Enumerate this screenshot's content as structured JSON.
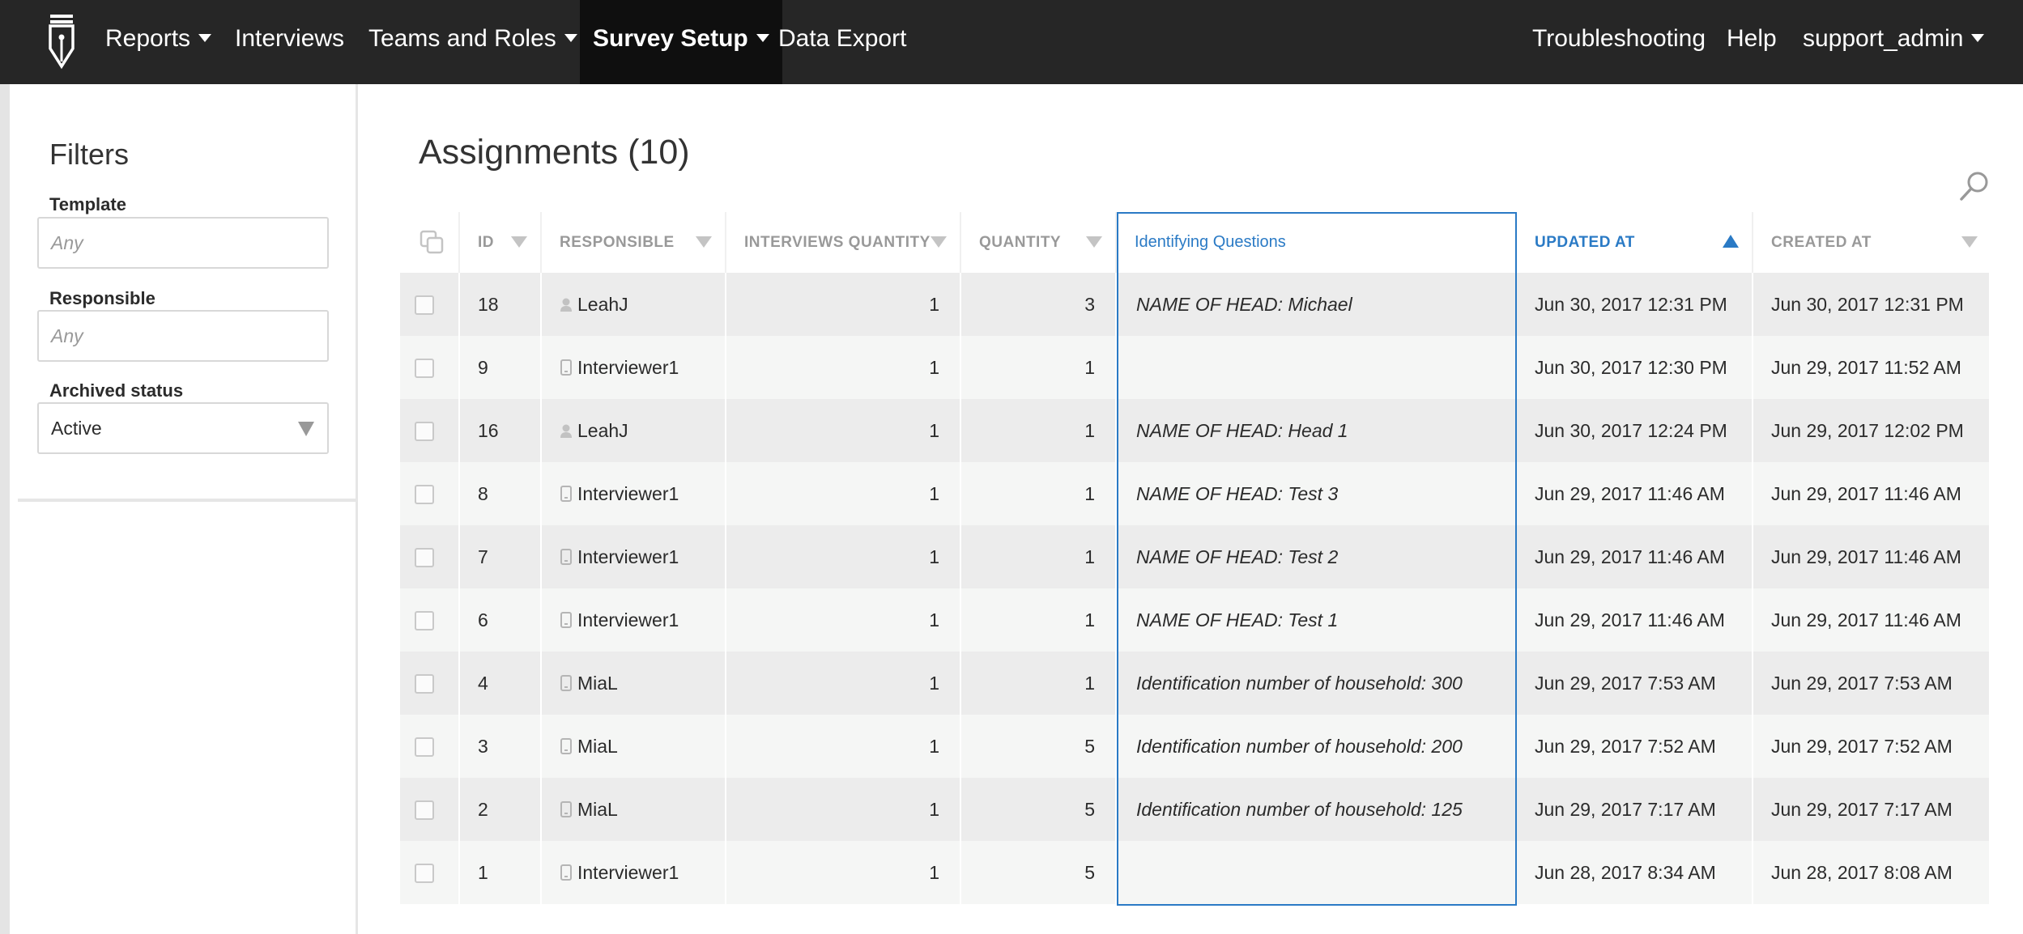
{
  "nav": {
    "logo_icon": "pen-nib-logo-icon",
    "items": [
      {
        "label": "Reports",
        "has_caret": true
      },
      {
        "label": "Interviews",
        "has_caret": false
      },
      {
        "label": "Teams and Roles",
        "has_caret": true
      },
      {
        "label": "Survey Setup",
        "has_caret": true,
        "active": true
      },
      {
        "label": "Data Export",
        "has_caret": false
      }
    ],
    "right": {
      "troubleshooting": "Troubleshooting",
      "help": "Help",
      "user": "support_admin"
    }
  },
  "filters": {
    "title": "Filters",
    "template_label": "Template",
    "template_placeholder": "Any",
    "responsible_label": "Responsible",
    "responsible_placeholder": "Any",
    "archived_label": "Archived status",
    "archived_value": "Active"
  },
  "main": {
    "title": "Assignments (10)",
    "search_icon": "search-icon"
  },
  "table": {
    "columns": {
      "id": "ID",
      "responsible": "RESPONSIBLE",
      "interviews_quantity": "INTERVIEWS QUANTITY",
      "quantity": "QUANTITY",
      "identifying_questions": "Identifying Questions",
      "updated_at": "UPDATED AT",
      "created_at": "CREATED AT"
    },
    "sorted_column": "updated_at",
    "sort_direction": "ascending",
    "accent_color": "#2a7ac5",
    "rows": [
      {
        "id": "18",
        "responsible": "LeahJ",
        "resp_icon": "supervisor-person-icon",
        "interviews_quantity": "1",
        "quantity": "3",
        "identifying": "NAME OF HEAD: Michael",
        "updated": "Jun 30, 2017 12:31 PM",
        "created": "Jun 30, 2017 12:31 PM"
      },
      {
        "id": "9",
        "responsible": "Interviewer1",
        "resp_icon": "tablet-icon",
        "interviews_quantity": "1",
        "quantity": "1",
        "identifying": "",
        "updated": "Jun 30, 2017 12:30 PM",
        "created": "Jun 29, 2017 11:52 AM"
      },
      {
        "id": "16",
        "responsible": "LeahJ",
        "resp_icon": "supervisor-person-icon",
        "interviews_quantity": "1",
        "quantity": "1",
        "identifying": "NAME OF HEAD: Head 1",
        "updated": "Jun 30, 2017 12:24 PM",
        "created": "Jun 29, 2017 12:02 PM"
      },
      {
        "id": "8",
        "responsible": "Interviewer1",
        "resp_icon": "tablet-icon",
        "interviews_quantity": "1",
        "quantity": "1",
        "identifying": "NAME OF HEAD: Test 3",
        "updated": "Jun 29, 2017 11:46 AM",
        "created": "Jun 29, 2017 11:46 AM"
      },
      {
        "id": "7",
        "responsible": "Interviewer1",
        "resp_icon": "tablet-icon",
        "interviews_quantity": "1",
        "quantity": "1",
        "identifying": "NAME OF HEAD: Test 2",
        "updated": "Jun 29, 2017 11:46 AM",
        "created": "Jun 29, 2017 11:46 AM"
      },
      {
        "id": "6",
        "responsible": "Interviewer1",
        "resp_icon": "tablet-icon",
        "interviews_quantity": "1",
        "quantity": "1",
        "identifying": "NAME OF HEAD: Test 1",
        "updated": "Jun 29, 2017 11:46 AM",
        "created": "Jun 29, 2017 11:46 AM"
      },
      {
        "id": "4",
        "responsible": "MiaL",
        "resp_icon": "tablet-icon",
        "interviews_quantity": "1",
        "quantity": "1",
        "identifying": "Identification number of household: 300",
        "updated": "Jun 29, 2017 7:53 AM",
        "created": "Jun 29, 2017 7:53 AM"
      },
      {
        "id": "3",
        "responsible": "MiaL",
        "resp_icon": "tablet-icon",
        "interviews_quantity": "1",
        "quantity": "5",
        "identifying": "Identification number of household: 200",
        "updated": "Jun 29, 2017 7:52 AM",
        "created": "Jun 29, 2017 7:52 AM"
      },
      {
        "id": "2",
        "responsible": "MiaL",
        "resp_icon": "tablet-icon",
        "interviews_quantity": "1",
        "quantity": "5",
        "identifying": "Identification number of household: 125",
        "updated": "Jun 29, 2017 7:17 AM",
        "created": "Jun 29, 2017 7:17 AM"
      },
      {
        "id": "1",
        "responsible": "Interviewer1",
        "resp_icon": "tablet-icon",
        "interviews_quantity": "1",
        "quantity": "5",
        "identifying": "",
        "updated": "Jun 28, 2017 8:34 AM",
        "created": "Jun 28, 2017 8:08 AM"
      }
    ]
  }
}
